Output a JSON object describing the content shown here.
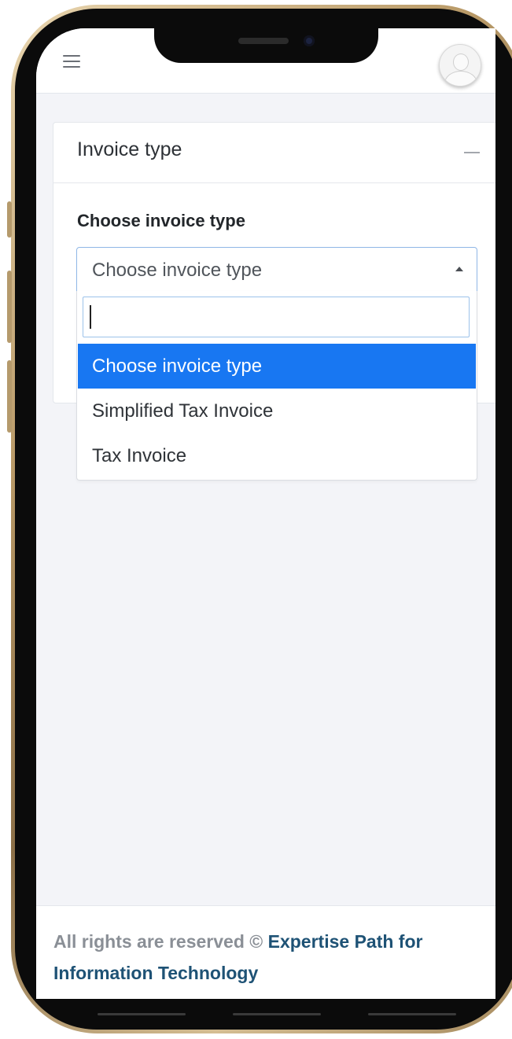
{
  "card": {
    "title": "Invoice type",
    "field_label": "Choose invoice type"
  },
  "select": {
    "selected_value": "Choose invoice type",
    "search_value": "",
    "options": [
      {
        "label": "Choose invoice type",
        "selected": true
      },
      {
        "label": "Simplified Tax Invoice",
        "selected": false
      },
      {
        "label": "Tax Invoice",
        "selected": false
      }
    ]
  },
  "footer": {
    "prefix": "All rights are reserved © ",
    "link_part1": "Expertise Path for",
    "link_part2": "Information Technology"
  },
  "colors": {
    "accent": "#1877f2",
    "footer_link": "#1e5275",
    "background": "#f3f4f8"
  },
  "icons": [
    "menu-icon",
    "avatar-icon",
    "collapse-icon",
    "caret-up-icon"
  ]
}
